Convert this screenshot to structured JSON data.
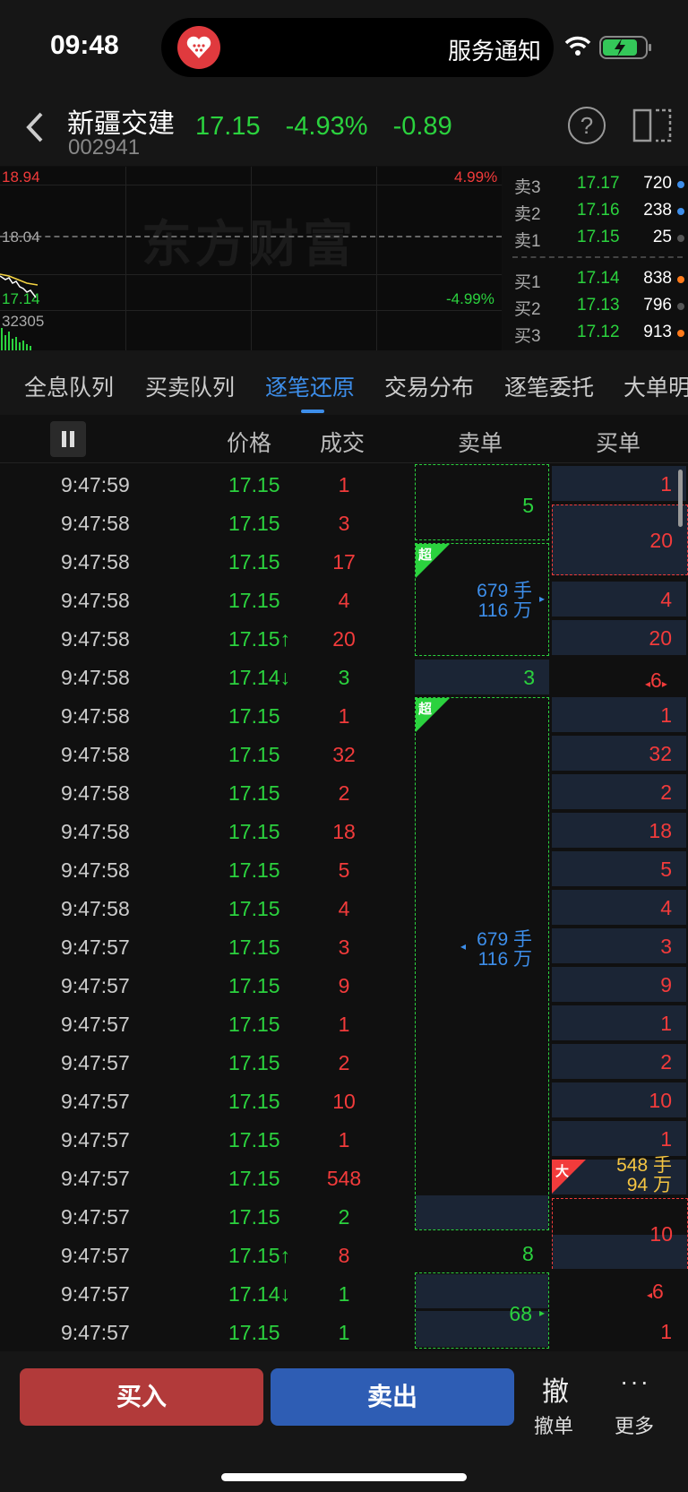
{
  "status": {
    "time": "09:48",
    "notice": "服务通知"
  },
  "stock": {
    "name": "新疆交建",
    "code": "002941",
    "price": "17.15",
    "pct": "-4.93%",
    "change": "-0.89"
  },
  "chart": {
    "high": "18.94",
    "pct_high": "4.99%",
    "mid": "18.04",
    "low": "17.14",
    "pct_low": "-4.99%",
    "volume": "32305",
    "watermark": "东方财富"
  },
  "order_book": {
    "asks": [
      {
        "label": "卖3",
        "price": "17.17",
        "volume": "720",
        "dot": "#3d8eea"
      },
      {
        "label": "卖2",
        "price": "17.16",
        "volume": "238",
        "dot": "#3d8eea"
      },
      {
        "label": "卖1",
        "price": "17.15",
        "volume": "25",
        "dot": "#555555"
      }
    ],
    "bids": [
      {
        "label": "买1",
        "price": "17.14",
        "volume": "838",
        "dot": "#ff7a1a"
      },
      {
        "label": "买2",
        "price": "17.13",
        "volume": "796",
        "dot": "#555555"
      },
      {
        "label": "买3",
        "price": "17.12",
        "volume": "913",
        "dot": "#ff7a1a"
      }
    ]
  },
  "tabs": [
    "全息队列",
    "买卖队列",
    "逐笔还原",
    "交易分布",
    "逐笔委托",
    "大单明"
  ],
  "columns": {
    "price": "价格",
    "volume": "成交",
    "sell": "卖单",
    "buy": "买单"
  },
  "trades": [
    {
      "time": "9:47:59",
      "price": "17.15",
      "vol": "1",
      "c": "red"
    },
    {
      "time": "9:47:58",
      "price": "17.15",
      "vol": "3",
      "c": "red"
    },
    {
      "time": "9:47:58",
      "price": "17.15",
      "vol": "17",
      "c": "red"
    },
    {
      "time": "9:47:58",
      "price": "17.15",
      "vol": "4",
      "c": "red"
    },
    {
      "time": "9:47:58",
      "price": "17.15↑",
      "vol": "20",
      "c": "red"
    },
    {
      "time": "9:47:58",
      "price": "17.14↓",
      "vol": "3",
      "c": "green"
    },
    {
      "time": "9:47:58",
      "price": "17.15",
      "vol": "1",
      "c": "red"
    },
    {
      "time": "9:47:58",
      "price": "17.15",
      "vol": "32",
      "c": "red"
    },
    {
      "time": "9:47:58",
      "price": "17.15",
      "vol": "2",
      "c": "red"
    },
    {
      "time": "9:47:58",
      "price": "17.15",
      "vol": "18",
      "c": "red"
    },
    {
      "time": "9:47:58",
      "price": "17.15",
      "vol": "5",
      "c": "red"
    },
    {
      "time": "9:47:58",
      "price": "17.15",
      "vol": "4",
      "c": "red"
    },
    {
      "time": "9:47:57",
      "price": "17.15",
      "vol": "3",
      "c": "red"
    },
    {
      "time": "9:47:57",
      "price": "17.15",
      "vol": "9",
      "c": "red"
    },
    {
      "time": "9:47:57",
      "price": "17.15",
      "vol": "1",
      "c": "red"
    },
    {
      "time": "9:47:57",
      "price": "17.15",
      "vol": "2",
      "c": "red"
    },
    {
      "time": "9:47:57",
      "price": "17.15",
      "vol": "10",
      "c": "red"
    },
    {
      "time": "9:47:57",
      "price": "17.15",
      "vol": "1",
      "c": "red"
    },
    {
      "time": "9:47:57",
      "price": "17.15",
      "vol": "548",
      "c": "red"
    },
    {
      "time": "9:47:57",
      "price": "17.15",
      "vol": "2",
      "c": "green"
    },
    {
      "time": "9:47:57",
      "price": "17.15↑",
      "vol": "8",
      "c": "red"
    },
    {
      "time": "9:47:57",
      "price": "17.14↓",
      "vol": "1",
      "c": "green"
    },
    {
      "time": "9:47:57",
      "price": "17.15",
      "vol": "1",
      "c": "green"
    }
  ],
  "sell_orders": {
    "o1": "5",
    "tag_super": "超",
    "big1_line1": "679 手",
    "big1_line2": "116 万",
    "o3": "3",
    "big2_line1": "679 手",
    "big2_line2": "116 万",
    "o8": "8",
    "o68": "68"
  },
  "buy_orders": {
    "cells": [
      "1",
      "",
      "",
      "4",
      "20",
      "",
      "1",
      "32",
      "2",
      "18",
      "5",
      "4",
      "3",
      "9",
      "1",
      "2",
      "10",
      "1",
      "",
      "",
      "",
      "",
      "1"
    ],
    "merged20": "20",
    "marker6": "6",
    "tag_big": "大",
    "big_line1": "548 手",
    "big_line2": "94 万",
    "merged10": "10",
    "marker6b": "6"
  },
  "bottom": {
    "buy": "买入",
    "sell": "卖出",
    "cancel_icon": "撤",
    "cancel": "撤单",
    "more_icon": "···",
    "more": "更多"
  }
}
